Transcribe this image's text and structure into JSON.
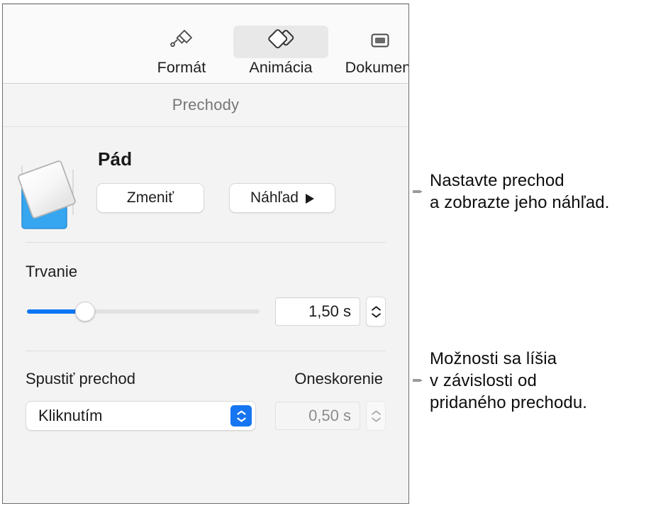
{
  "tabs": [
    {
      "label": "Formát",
      "icon": "paintbrush-icon",
      "active": false
    },
    {
      "label": "Animácia",
      "icon": "overlapping-diamonds-icon",
      "active": true
    },
    {
      "label": "Dokument",
      "icon": "document-frame-icon",
      "active": false
    }
  ],
  "section": {
    "title": "Prechody"
  },
  "transition": {
    "name": "Pád",
    "change_label": "Zmeniť",
    "preview_label": "Náhľad",
    "thumbnail": "falling-square-transition-icon"
  },
  "duration": {
    "label": "Trvanie",
    "value": "1,50 s",
    "slider_percent": 25
  },
  "start": {
    "label": "Spustiť prechod",
    "value": "Kliknutím",
    "delay_label": "Oneskorenie",
    "delay_value": "0,50 s",
    "delay_disabled": true
  },
  "callouts": [
    {
      "lines": [
        "Nastavte prechod",
        "a zobrazte jeho náhľad."
      ]
    },
    {
      "lines": [
        "Možnosti sa líšia",
        "v závislosti od",
        "pridaného prechodu."
      ]
    }
  ],
  "colors": {
    "accent_blue": "#0a76f5",
    "popup_blue": "#1675f0",
    "thumb_blue": "#35a6ef",
    "panel_bg": "#f3f3f3",
    "bracket_gray": "#9b9b9b"
  }
}
